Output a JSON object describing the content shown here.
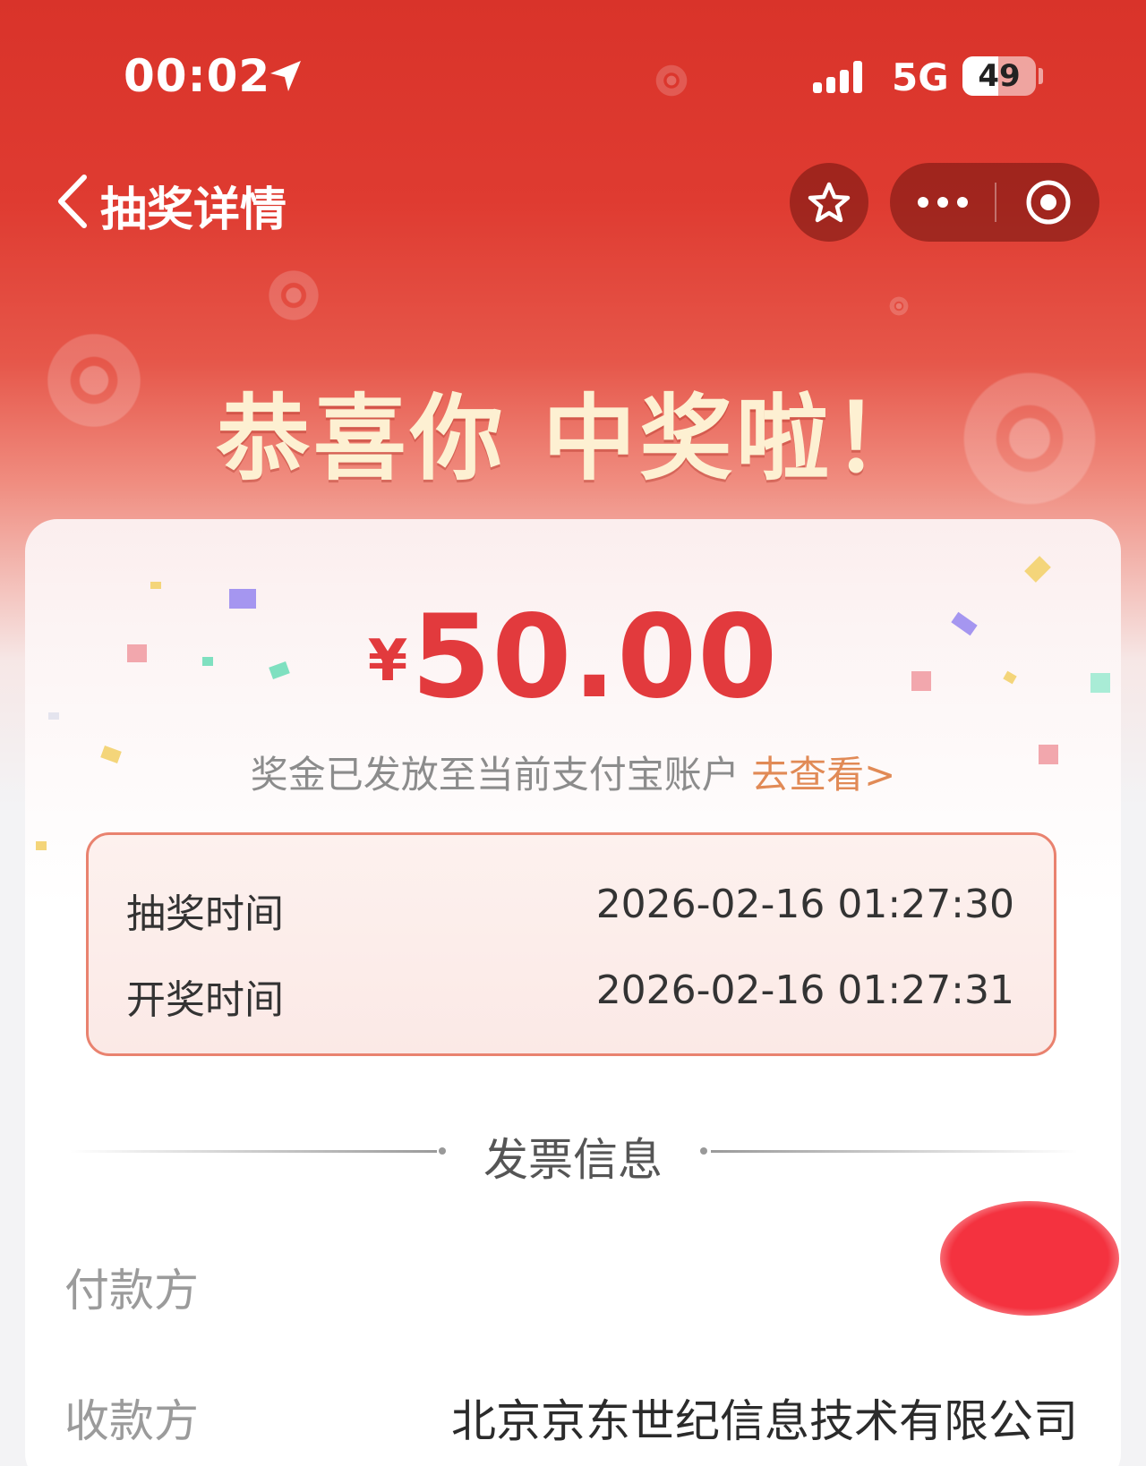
{
  "status_bar": {
    "time": "00:02",
    "network": "5G",
    "battery": "49",
    "battery_level": 0.49
  },
  "nav": {
    "title": "抽奖详情"
  },
  "headline": "恭喜你 中奖啦！",
  "prize": {
    "currency_symbol": "¥",
    "amount": "50.00",
    "notice": "奖金已发放至当前支付宝账户",
    "notice_link": "去查看>"
  },
  "times": [
    {
      "label": "抽奖时间",
      "value": "2026-02-16 01:27:30"
    },
    {
      "label": "开奖时间",
      "value": "2026-02-16 01:27:31"
    }
  ],
  "invoice": {
    "title": "发票信息",
    "payer_label": "付款方",
    "payee_label": "收款方",
    "payee_value": "北京京东世纪信息技术有限公司"
  },
  "colors": {
    "header_red": "#d9332a",
    "amount_red": "#e23a3d",
    "link_orange": "#e18a56",
    "box_border": "#e9826f",
    "redaction": "#f4323f"
  }
}
